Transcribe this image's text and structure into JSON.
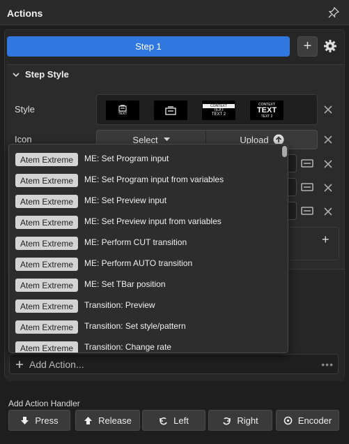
{
  "header": {
    "title": "Actions",
    "pin_icon": "pin-icon"
  },
  "steps": {
    "active_label": "Step 1",
    "add_label": "+"
  },
  "step_style": {
    "title": "Step Style",
    "style_label": "Style",
    "icon_label": "Icon",
    "style_options": [
      {
        "small": "TEXT",
        "big": ""
      },
      {
        "small": "",
        "big": ""
      },
      {
        "small": "CONTEXT",
        "mid": "TEXT",
        "sub": "TEXT 2"
      },
      {
        "small": "CONTEXT",
        "big": "TEXT",
        "sub": "TEXT 2"
      }
    ],
    "icon_select_label": "Select",
    "icon_upload_label": "Upload"
  },
  "dropdown": {
    "items": [
      {
        "tag": "Atem Extreme",
        "label": "ME: Set Program input"
      },
      {
        "tag": "Atem Extreme",
        "label": "ME: Set Program input from variables"
      },
      {
        "tag": "Atem Extreme",
        "label": "ME: Set Preview input"
      },
      {
        "tag": "Atem Extreme",
        "label": "ME: Set Preview input from variables"
      },
      {
        "tag": "Atem Extreme",
        "label": "ME: Perform CUT transition"
      },
      {
        "tag": "Atem Extreme",
        "label": "ME: Perform AUTO transition"
      },
      {
        "tag": "Atem Extreme",
        "label": "ME: Set TBar position"
      },
      {
        "tag": "Atem Extreme",
        "label": "Transition: Preview"
      },
      {
        "tag": "Atem Extreme",
        "label": "Transition: Set style/pattern"
      },
      {
        "tag": "Atem Extreme",
        "label": "Transition: Change rate"
      }
    ]
  },
  "add_action": {
    "placeholder": "Add Action...",
    "more": "•••"
  },
  "handler": {
    "label": "Add Action Handler",
    "buttons": [
      "Press",
      "Release",
      "Left",
      "Right",
      "Encoder"
    ]
  },
  "colors": {
    "accent": "#3078e0",
    "background": "#1e1e1e"
  }
}
